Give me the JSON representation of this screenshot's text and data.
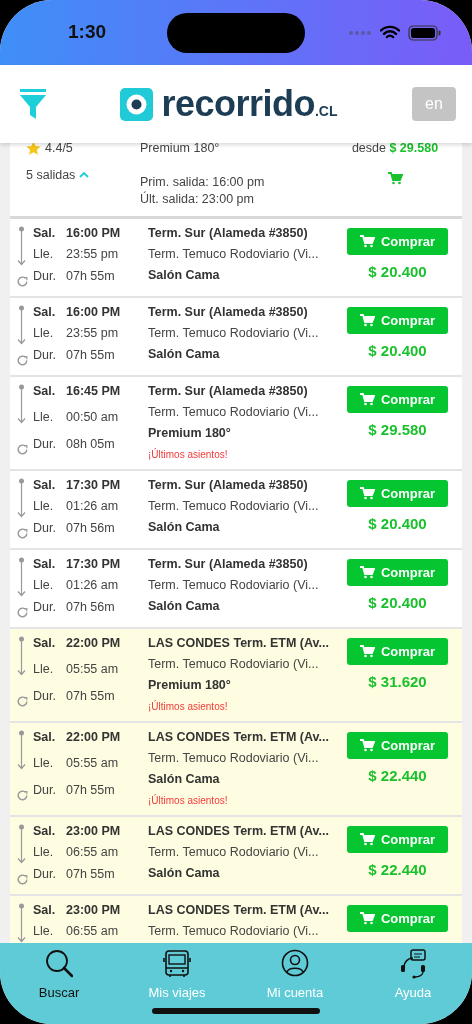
{
  "status_bar": {
    "time": "1:30"
  },
  "header": {
    "logo_text": "recorrido",
    "logo_suffix": ".CL",
    "language_button": {
      "label": "en",
      "disabled": true
    }
  },
  "summary": {
    "rating": "4.4/5",
    "departures_toggle": {
      "label": "5 salidas",
      "expanded": true
    },
    "seat_class": "Premium 180°",
    "first_departure": "Prim. salida: 16:00 pm",
    "last_departure": "Últ. salida: 23:00 pm",
    "price_prefix": "desde",
    "price": "$ 29.580"
  },
  "trips": [
    {
      "departure_label": "Sal.",
      "departure": "16:00 PM",
      "arrival_label": "Lle.",
      "arrival": "23:55 pm",
      "duration_label": "Dur.",
      "duration": "07h 55m",
      "origin": "Term. Sur (Alameda #3850)",
      "destination": "Term. Temuco Rodoviario (Vi...",
      "seat_class": "Salón Cama",
      "button": "Comprar",
      "price": "$ 20.400",
      "highlighted": false
    },
    {
      "departure_label": "Sal.",
      "departure": "16:00 PM",
      "arrival_label": "Lle.",
      "arrival": "23:55 pm",
      "duration_label": "Dur.",
      "duration": "07h 55m",
      "origin": "Term. Sur (Alameda #3850)",
      "destination": "Term. Temuco Rodoviario (Vi...",
      "seat_class": "Salón Cama",
      "button": "Comprar",
      "price": "$ 20.400",
      "highlighted": false
    },
    {
      "departure_label": "Sal.",
      "departure": "16:45 PM",
      "arrival_label": "Lle.",
      "arrival": "00:50 am",
      "duration_label": "Dur.",
      "duration": "08h 05m",
      "origin": "Term. Sur (Alameda #3850)",
      "destination": "Term. Temuco Rodoviario (Vi...",
      "seat_class": "Premium 180°",
      "warning": "¡Últimos asientos!",
      "button": "Comprar",
      "price": "$ 29.580",
      "highlighted": false
    },
    {
      "departure_label": "Sal.",
      "departure": "17:30 PM",
      "arrival_label": "Lle.",
      "arrival": "01:26 am",
      "duration_label": "Dur.",
      "duration": "07h 56m",
      "origin": "Term. Sur (Alameda #3850)",
      "destination": "Term. Temuco Rodoviario (Vi...",
      "seat_class": "Salón Cama",
      "button": "Comprar",
      "price": "$ 20.400",
      "highlighted": false
    },
    {
      "departure_label": "Sal.",
      "departure": "17:30 PM",
      "arrival_label": "Lle.",
      "arrival": "01:26 am",
      "duration_label": "Dur.",
      "duration": "07h 56m",
      "origin": "Term. Sur (Alameda #3850)",
      "destination": "Term. Temuco Rodoviario (Vi...",
      "seat_class": "Salón Cama",
      "button": "Comprar",
      "price": "$ 20.400",
      "highlighted": false
    },
    {
      "departure_label": "Sal.",
      "departure": "22:00 PM",
      "arrival_label": "Lle.",
      "arrival": "05:55 am",
      "duration_label": "Dur.",
      "duration": "07h 55m",
      "origin": "LAS CONDES Term. ETM (Av...",
      "destination": "Term. Temuco Rodoviario (Vi...",
      "seat_class": "Premium 180°",
      "warning": "¡Últimos asientos!",
      "button": "Comprar",
      "price": "$ 31.620",
      "highlighted": true
    },
    {
      "departure_label": "Sal.",
      "departure": "22:00 PM",
      "arrival_label": "Lle.",
      "arrival": "05:55 am",
      "duration_label": "Dur.",
      "duration": "07h 55m",
      "origin": "LAS CONDES Term. ETM (Av...",
      "destination": "Term. Temuco Rodoviario (Vi...",
      "seat_class": "Salón Cama",
      "warning": "¡Últimos asientos!",
      "button": "Comprar",
      "price": "$ 22.440",
      "highlighted": true
    },
    {
      "departure_label": "Sal.",
      "departure": "23:00 PM",
      "arrival_label": "Lle.",
      "arrival": "06:55 am",
      "duration_label": "Dur.",
      "duration": "07h 55m",
      "origin": "LAS CONDES Term. ETM (Av...",
      "destination": "Term. Temuco Rodoviario (Vi...",
      "seat_class": "Salón Cama",
      "button": "Comprar",
      "price": "$ 22.440",
      "highlighted": true
    },
    {
      "departure_label": "Sal.",
      "departure": "23:00 PM",
      "arrival_label": "Lle.",
      "arrival": "06:55 am",
      "origin": "LAS CONDES Term. ETM (Av...",
      "destination": "Term. Temuco Rodoviario (Vi...",
      "button": "Comprar",
      "highlighted": true
    }
  ],
  "bottom_nav": [
    {
      "label": "Buscar",
      "selected": true
    },
    {
      "label": "Mis viajes",
      "selected": false
    },
    {
      "label": "Mi cuenta",
      "selected": false
    },
    {
      "label": "Ayuda",
      "selected": false
    }
  ]
}
